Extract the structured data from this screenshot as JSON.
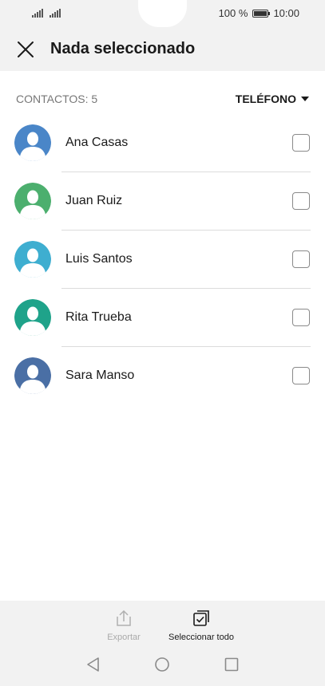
{
  "status": {
    "battery_text": "100 %",
    "time": "10:00"
  },
  "header": {
    "title": "Nada seleccionado"
  },
  "list_header": {
    "count_label": "CONTACTOS: 5",
    "sort_label": "TELÉFONO"
  },
  "contacts": [
    {
      "name": "Ana Casas",
      "color": "#4a86c8"
    },
    {
      "name": "Juan Ruiz",
      "color": "#4caf6e"
    },
    {
      "name": "Luis Santos",
      "color": "#3eaed0"
    },
    {
      "name": "Rita Trueba",
      "color": "#1fa38a"
    },
    {
      "name": "Sara Manso",
      "color": "#4a6fa5"
    }
  ],
  "bottom_bar": {
    "export_label": "Exportar",
    "select_all_label": "Seleccionar todo"
  },
  "icons": {
    "close": "close-icon",
    "caret": "caret-down-icon",
    "export": "export-icon",
    "select_all": "select-all-icon",
    "back": "back-icon",
    "home": "home-icon",
    "recents": "recents-icon"
  }
}
